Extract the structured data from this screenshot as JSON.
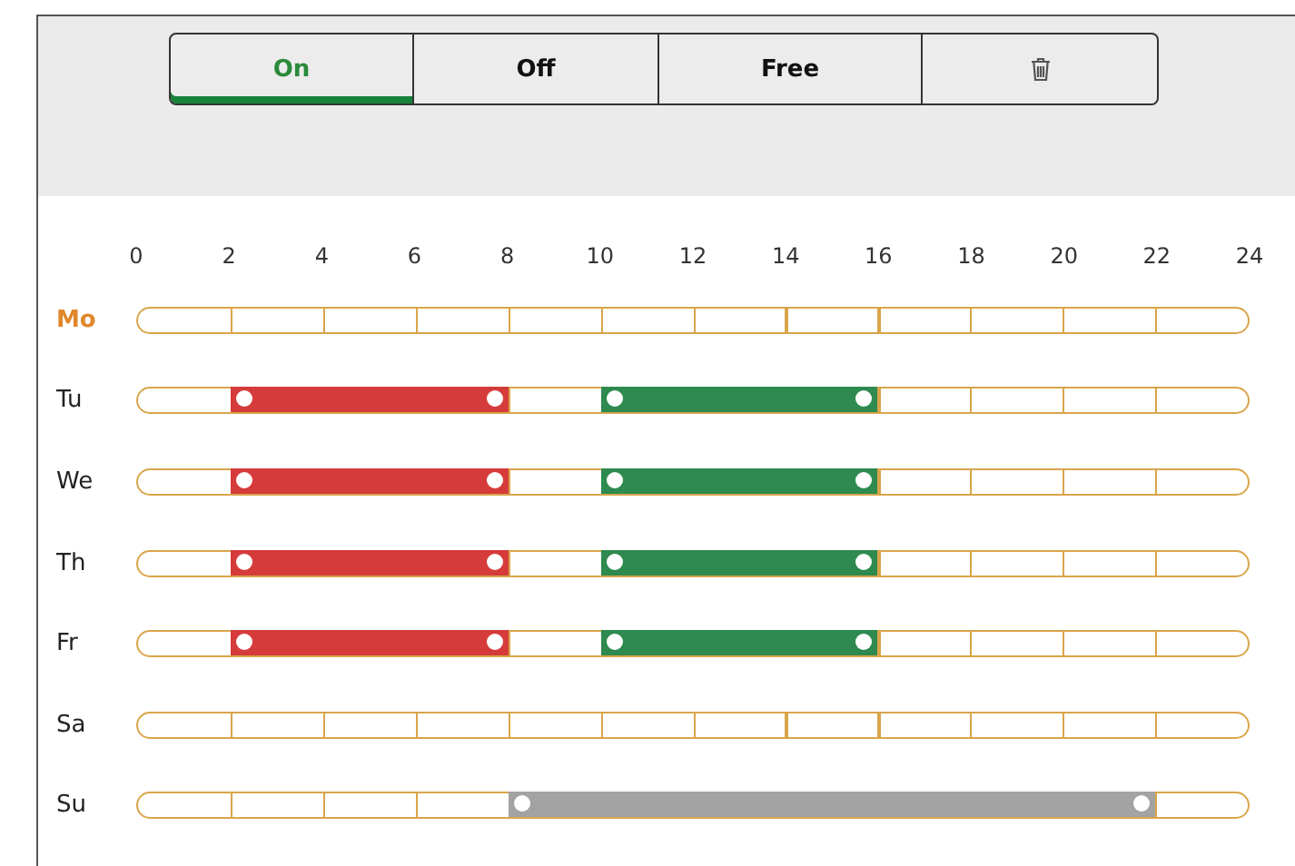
{
  "modes": [
    {
      "label": "On",
      "selected": true
    },
    {
      "label": "Off",
      "selected": false
    },
    {
      "label": "Free",
      "selected": false
    }
  ],
  "hours": [
    "0",
    "2",
    "4",
    "6",
    "8",
    "10",
    "12",
    "14",
    "16",
    "18",
    "20",
    "22",
    "24"
  ],
  "days": [
    {
      "label": "Mo",
      "selected": true,
      "slots": [
        {
          "kind": "empty"
        },
        {
          "kind": "empty"
        },
        {
          "kind": "empty"
        },
        {
          "kind": "empty"
        },
        {
          "kind": "empty"
        },
        {
          "kind": "empty"
        },
        {
          "kind": "empty"
        },
        {
          "kind": "empty"
        },
        {
          "kind": "empty"
        },
        {
          "kind": "empty"
        },
        {
          "kind": "empty"
        },
        {
          "kind": "empty"
        }
      ]
    },
    {
      "label": "Tu",
      "selected": false,
      "slots": [
        {
          "kind": "empty"
        },
        {
          "kind": "off"
        },
        {
          "kind": "off"
        },
        {
          "kind": "off"
        },
        {
          "kind": "empty"
        },
        {
          "kind": "on"
        },
        {
          "kind": "on"
        },
        {
          "kind": "on"
        },
        {
          "kind": "empty"
        },
        {
          "kind": "empty"
        },
        {
          "kind": "empty"
        },
        {
          "kind": "empty"
        }
      ]
    },
    {
      "label": "We",
      "selected": false,
      "slots": [
        {
          "kind": "empty"
        },
        {
          "kind": "off"
        },
        {
          "kind": "off"
        },
        {
          "kind": "off"
        },
        {
          "kind": "empty"
        },
        {
          "kind": "on"
        },
        {
          "kind": "on"
        },
        {
          "kind": "on"
        },
        {
          "kind": "empty"
        },
        {
          "kind": "empty"
        },
        {
          "kind": "empty"
        },
        {
          "kind": "empty"
        }
      ]
    },
    {
      "label": "Th",
      "selected": false,
      "slots": [
        {
          "kind": "empty"
        },
        {
          "kind": "off"
        },
        {
          "kind": "off"
        },
        {
          "kind": "off"
        },
        {
          "kind": "empty"
        },
        {
          "kind": "on"
        },
        {
          "kind": "on"
        },
        {
          "kind": "on"
        },
        {
          "kind": "empty"
        },
        {
          "kind": "empty"
        },
        {
          "kind": "empty"
        },
        {
          "kind": "empty"
        }
      ]
    },
    {
      "label": "Fr",
      "selected": false,
      "slots": [
        {
          "kind": "empty"
        },
        {
          "kind": "off"
        },
        {
          "kind": "off"
        },
        {
          "kind": "off"
        },
        {
          "kind": "empty"
        },
        {
          "kind": "on"
        },
        {
          "kind": "on"
        },
        {
          "kind": "on"
        },
        {
          "kind": "empty"
        },
        {
          "kind": "empty"
        },
        {
          "kind": "empty"
        },
        {
          "kind": "empty"
        }
      ]
    },
    {
      "label": "Sa",
      "selected": false,
      "slots": [
        {
          "kind": "empty"
        },
        {
          "kind": "empty"
        },
        {
          "kind": "empty"
        },
        {
          "kind": "empty"
        },
        {
          "kind": "empty"
        },
        {
          "kind": "empty"
        },
        {
          "kind": "empty"
        },
        {
          "kind": "empty"
        },
        {
          "kind": "empty"
        },
        {
          "kind": "empty"
        },
        {
          "kind": "empty"
        },
        {
          "kind": "empty"
        }
      ]
    },
    {
      "label": "Su",
      "selected": false,
      "slots": [
        {
          "kind": "empty"
        },
        {
          "kind": "empty"
        },
        {
          "kind": "empty"
        },
        {
          "kind": "empty"
        },
        {
          "kind": "free"
        },
        {
          "kind": "free"
        },
        {
          "kind": "free"
        },
        {
          "kind": "free"
        },
        {
          "kind": "free"
        },
        {
          "kind": "free"
        },
        {
          "kind": "free"
        },
        {
          "kind": "empty"
        }
      ]
    }
  ]
}
